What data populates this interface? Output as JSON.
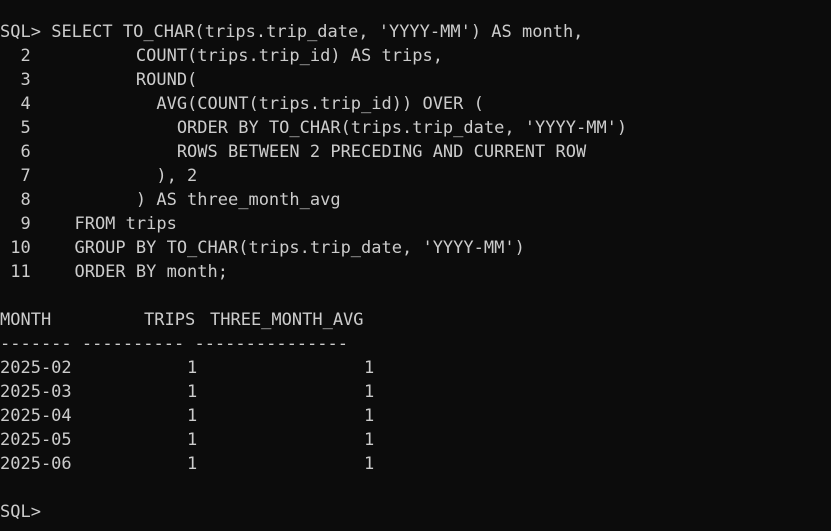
{
  "terminal": {
    "prompt": "SQL>",
    "query_lines": [
      {
        "num": "SQL> ",
        "code": "SELECT TO_CHAR(trips.trip_date, 'YYYY-MM') AS month,"
      },
      {
        "num": "  2",
        "code": "        COUNT(trips.trip_id) AS trips,"
      },
      {
        "num": "  3",
        "code": "        ROUND("
      },
      {
        "num": "  4",
        "code": "          AVG(COUNT(trips.trip_id)) OVER ("
      },
      {
        "num": "  5",
        "code": "            ORDER BY TO_CHAR(trips.trip_date, 'YYYY-MM')"
      },
      {
        "num": "  6",
        "code": "            ROWS BETWEEN 2 PRECEDING AND CURRENT ROW"
      },
      {
        "num": "  7",
        "code": "          ), 2"
      },
      {
        "num": "  8",
        "code": "        ) AS three_month_avg"
      },
      {
        "num": "  9",
        "code": "  FROM trips"
      },
      {
        "num": " 10",
        "code": "  GROUP BY TO_CHAR(trips.trip_date, 'YYYY-MM')"
      },
      {
        "num": " 11",
        "code": "  ORDER BY month;"
      }
    ],
    "result": {
      "headers": {
        "month": "MONTH",
        "trips": "TRIPS",
        "avg": "THREE_MONTH_AVG"
      },
      "separator": "------- ---------- ---------------",
      "rows": [
        {
          "month": "2025-02",
          "trips": "1",
          "avg": "1"
        },
        {
          "month": "2025-03",
          "trips": "1",
          "avg": "1"
        },
        {
          "month": "2025-04",
          "trips": "1",
          "avg": "1"
        },
        {
          "month": "2025-05",
          "trips": "1",
          "avg": "1"
        },
        {
          "month": "2025-06",
          "trips": "1",
          "avg": "1"
        }
      ]
    },
    "colors": {
      "background": "#0c0c0c",
      "foreground": "#cccccc"
    }
  }
}
